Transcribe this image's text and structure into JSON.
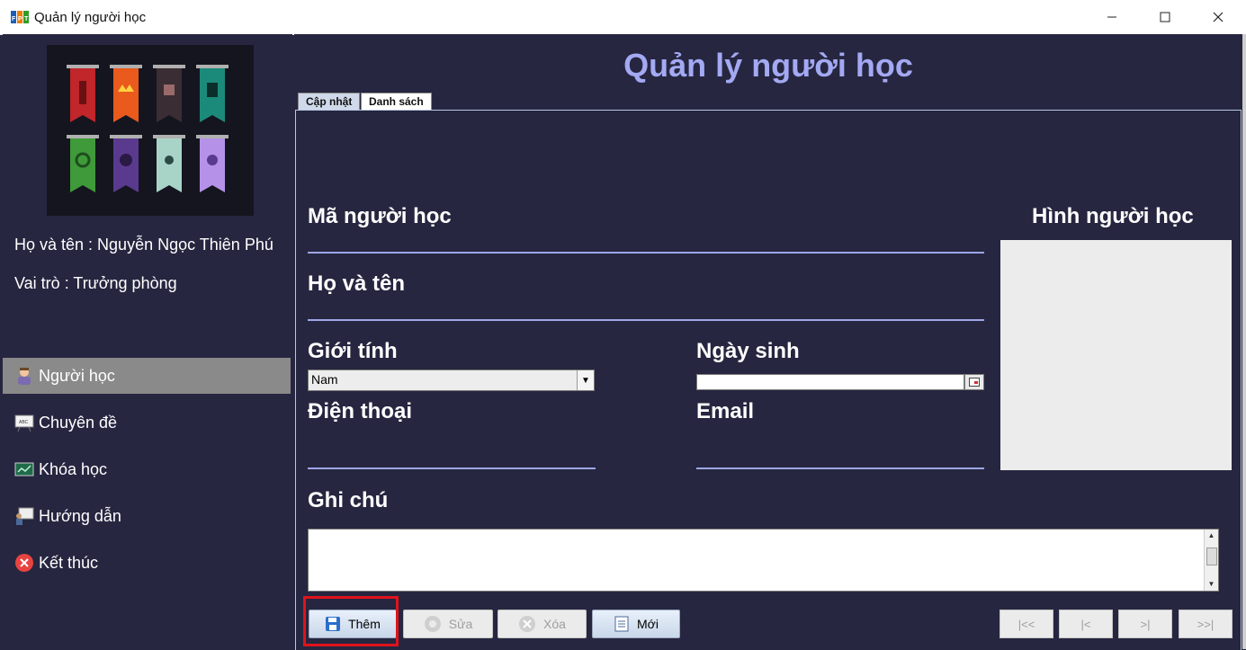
{
  "window": {
    "title": "Quản lý người học",
    "minimize": "—",
    "maximize": "☐",
    "close": "✕"
  },
  "user": {
    "name_line": "Họ và tên : Nguyễn Ngọc Thiên Phú",
    "role_line": "Vai trò : Trưởng phòng"
  },
  "menu": [
    {
      "label": "Người học",
      "icon": "student-icon",
      "active": true
    },
    {
      "label": "Chuyên đề",
      "icon": "board-icon"
    },
    {
      "label": "Khóa học",
      "icon": "chart-icon"
    },
    {
      "label": "Hướng dẫn",
      "icon": "teacher-icon"
    },
    {
      "label": "Kết thúc",
      "icon": "exit-icon"
    }
  ],
  "page": {
    "title": "Quản lý người học",
    "tabs": [
      {
        "label": "Cập nhật",
        "active": true
      },
      {
        "label": "Danh sách",
        "active": false
      }
    ]
  },
  "form": {
    "ma_label": "Mã người học",
    "hoten_label": "Họ và tên",
    "gioitinh_label": "Giới tính",
    "gioitinh_value": "Nam",
    "ngaysinh_label": "Ngày sinh",
    "ngaysinh_value": "",
    "dienthoai_label": "Điện thoại",
    "email_label": "Email",
    "ghichu_label": "Ghi chú",
    "hinh_label": "Hình người học"
  },
  "buttons": {
    "them": "Thêm",
    "sua": "Sửa",
    "xoa": "Xóa",
    "moi": "Mới",
    "first": "|<<",
    "prev": "|<",
    "next": ">|",
    "last": ">>|"
  },
  "colors": {
    "background": "#262640",
    "title": "#a3a9f2",
    "underline": "#9ea6e6",
    "highlight": "#e0131b"
  }
}
